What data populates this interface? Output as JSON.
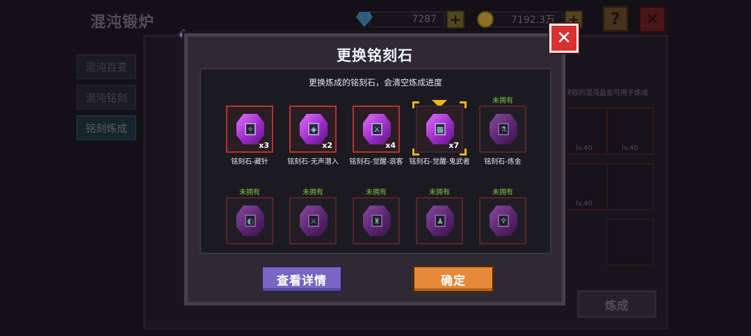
{
  "background": {
    "title": "混沌锻炉",
    "gems": "7287",
    "coins": "7192.3万",
    "help_label": "?",
    "close_label": "✕",
    "side_tabs": [
      "混沌百变",
      "混沌铭刻",
      "铭刻炼成"
    ],
    "right_note": "获取的混沌晶金可用于炼成",
    "slot_levels": [
      "lv.40",
      "lv.40",
      "lv.40"
    ],
    "forge_label": "炼成"
  },
  "modal": {
    "title": "更换铭刻石",
    "close_label": "✕",
    "notice": "更换炼成的铭刻石，会清空炼成进度",
    "details_label": "查看详情",
    "confirm_label": "确定",
    "unowned_label": "未拥有",
    "stones": [
      {
        "name": "铭刻石-藏针",
        "count": "x3",
        "icon": "✧"
      },
      {
        "name": "铭刻石-无声潜入",
        "count": "x2",
        "icon": "◈"
      },
      {
        "name": "铭刻石-觉醒-浪客",
        "count": "x4",
        "icon": "⚔"
      },
      {
        "name": "铭刻石-觉醒-鬼武者",
        "count": "x7",
        "icon": "▦"
      },
      {
        "name": "铭刻石-炼金",
        "count": "",
        "icon": "⚗"
      }
    ],
    "stones_row2_icons": [
      "◐",
      "⚔",
      "♜",
      "♟",
      "♆"
    ]
  }
}
